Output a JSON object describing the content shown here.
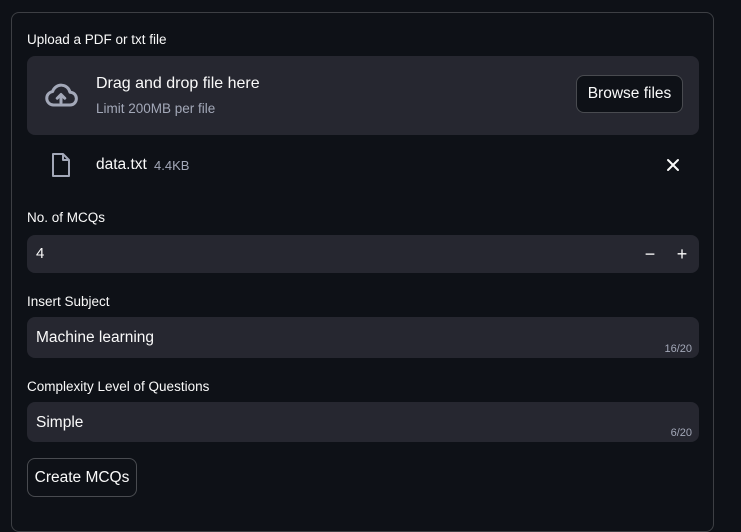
{
  "uploader": {
    "label": "Upload a PDF or txt file",
    "drop_title": "Drag and drop file here",
    "drop_limit": "Limit 200MB per file",
    "browse_label": "Browse files",
    "file": {
      "name": "data.txt",
      "size": "4.4KB"
    }
  },
  "mcq_count": {
    "label": "No. of MCQs",
    "value": "4",
    "decrement": "−",
    "increment": "+"
  },
  "subject": {
    "label": "Insert Subject",
    "value": "Machine learning",
    "counter": "16/20"
  },
  "complexity": {
    "label": "Complexity Level of Questions",
    "value": "Simple",
    "counter": "6/20"
  },
  "submit": {
    "label": "Create MCQs"
  },
  "icons": {
    "upload": "cloud-upload-icon",
    "file": "file-icon",
    "remove": "close-icon"
  },
  "colors": {
    "background": "#0e1117",
    "surface": "#262730",
    "text": "#fafafa",
    "muted": "#a3a8b8"
  }
}
